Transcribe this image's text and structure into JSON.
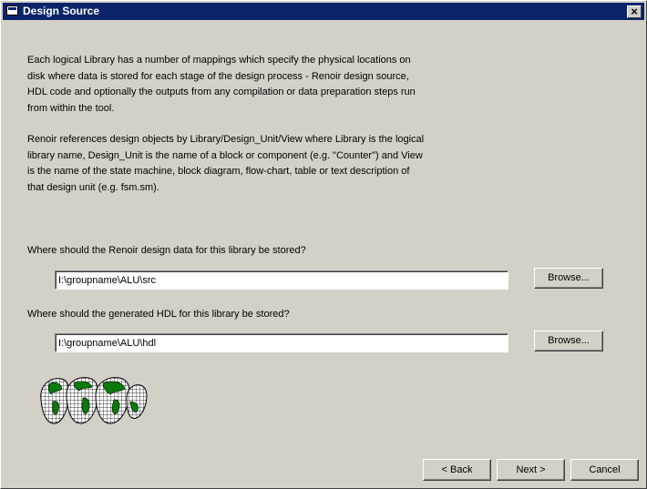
{
  "window": {
    "title": "Design Source",
    "close_label": "×"
  },
  "body": {
    "paragraph1": "Each logical Library has a number of mappings which specify the physical locations on disk where data is stored for each stage of the design process - Renoir design source, HDL code and optionally the outputs from any compilation or data preparation steps run from within the tool.",
    "paragraph2": "Renoir references design objects by Library/Design_Unit/View where Library is the logical library name, Design_Unit is the name of a block or component (e.g. \"Counter\") and View is the name of the state machine, block diagram, flow-chart, table or text description of that design unit (e.g. fsm.sm)."
  },
  "design_data": {
    "question": "Where should the Renoir design data for this library be stored?",
    "value": "I:\\groupname\\ALU\\src",
    "browse_label": "Browse..."
  },
  "hdl": {
    "question": "Where should the generated HDL for this library be stored?",
    "value": "I:\\groupname\\ALU\\hdl",
    "browse_label": "Browse..."
  },
  "footer": {
    "back_label": "< Back",
    "next_label": "Next >",
    "cancel_label": "Cancel"
  },
  "icons": {
    "app": "window-icon",
    "logo": "globe-map-logo"
  }
}
